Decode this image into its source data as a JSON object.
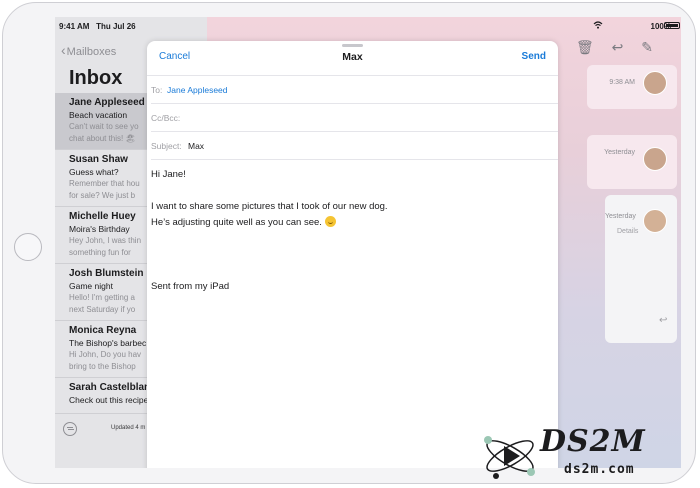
{
  "status_bar": {
    "time": "9:41 AM",
    "date": "Thu Jul 26",
    "battery": "100%"
  },
  "sidebar": {
    "back_label": "Mailboxes",
    "title": "Inbox",
    "items": [
      {
        "sender": "Jane Appleseed",
        "subject": "Beach vacation",
        "preview1": "Can't wait to see yo",
        "preview2": "chat about this! 🏖"
      },
      {
        "sender": "Susan Shaw",
        "subject": "Guess what?",
        "preview1": "Remember that hou",
        "preview2": "for sale? We just b"
      },
      {
        "sender": "Michelle Huey",
        "subject": "Moira's Birthday",
        "preview1": "Hey John, I was thin",
        "preview2": "something fun for"
      },
      {
        "sender": "Josh Blumstein",
        "subject": "Game night",
        "preview1": "Hello! I'm getting a",
        "preview2": "next Saturday if yo"
      },
      {
        "sender": "Monica Reyna",
        "subject": "The Bishop's barbec",
        "preview1": "Hi John, Do you hav",
        "preview2": "bring to the Bishop"
      },
      {
        "sender": "Sarah Castelblanco",
        "subject": "Check out this recipe",
        "preview1": "",
        "preview2": ""
      }
    ],
    "footer_status": "Updated 4 m"
  },
  "detail": {
    "cards": [
      {
        "time": "9:38 AM"
      },
      {
        "time": "Yesterday"
      },
      {
        "time": "Yesterday",
        "details_label": "Details"
      }
    ]
  },
  "compose": {
    "cancel_label": "Cancel",
    "title": "Max",
    "send_label": "Send",
    "to_label": "To:",
    "to_value": "Jane Appleseed",
    "cc_label": "Cc/Bcc:",
    "subject_label": "Subject:",
    "subject_value": "Max",
    "body_greeting": "Hi Jane!",
    "body_line1": "I want to share some pictures that I took of our new dog.",
    "body_line2": "He’s adjusting quite well as you can see.",
    "signature": "Sent from my iPad"
  },
  "watermark": {
    "brand": "DS2M",
    "url": "ds2m.com"
  },
  "colors": {
    "accent": "#1a7bd8",
    "sidebar_bg": "#e4e4e7",
    "selected_row": "#c9c9ce"
  }
}
